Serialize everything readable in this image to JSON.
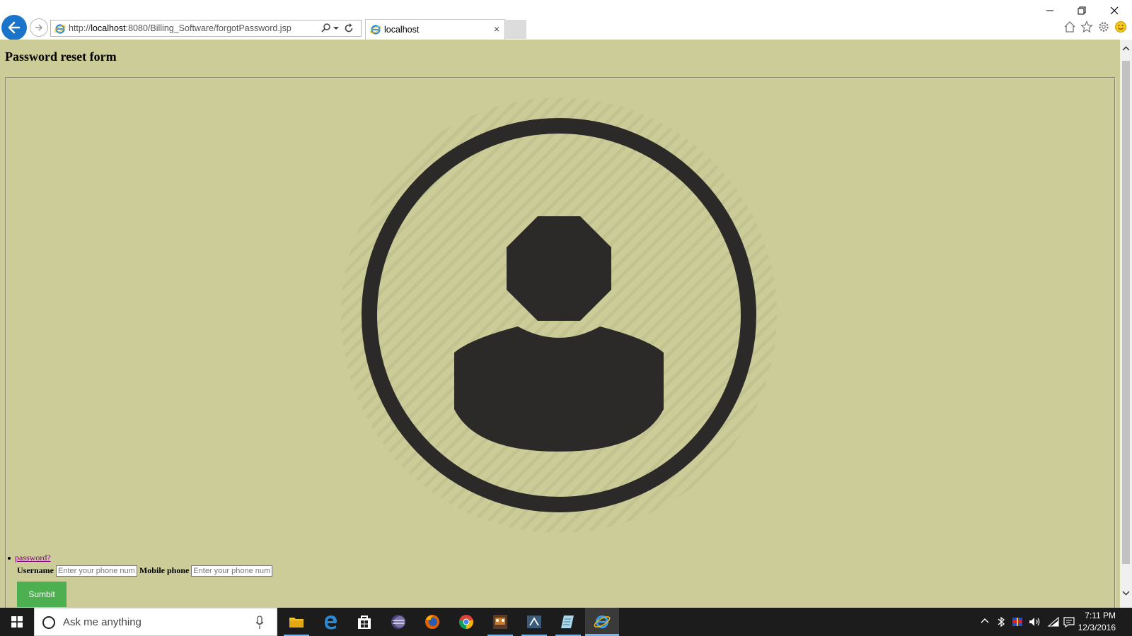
{
  "browser": {
    "url_prefix": "http://",
    "url_host": "localhost",
    "url_rest": ":8080/Billing_Software/forgotPassword.jsp",
    "tab_title": "localhost",
    "tab_close": "×"
  },
  "page": {
    "title": "Password reset form",
    "forgot_link": "password?",
    "form": {
      "username_label": "Username",
      "username_placeholder": "Enter your phone numb",
      "mobile_label": "Mobile phone",
      "mobile_placeholder": "Enter your phone numb",
      "submit_label": "Sumbit"
    }
  },
  "taskbar": {
    "search_placeholder": "Ask me anything",
    "time": "7:11 PM",
    "date": "12/3/2016"
  },
  "colors": {
    "page_bg": "#cccc99",
    "submit_bg": "#4caf50",
    "back_button": "#1a74c9",
    "avatar": "#2b2a28"
  }
}
